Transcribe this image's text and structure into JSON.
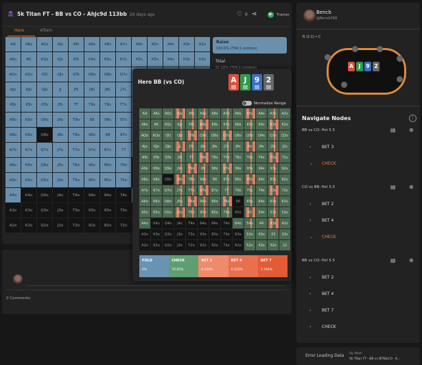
{
  "header": {
    "title": "5k Titan FT - BB vs CO - AhJc9d 113bb",
    "ago": "26 days ago",
    "like_count": "0",
    "trainer": "Trainer"
  },
  "tabs": {
    "hero": "Hero",
    "villain": "Villain"
  },
  "stats": {
    "raise_label": "Raise",
    "raise_value": "100.0% (704.1 combos)",
    "total_label": "Total",
    "total_value": "51.10% (704.1 combos)"
  },
  "overlay": {
    "title": "Hero BB (vs CO)",
    "normalize": "Normalize Range",
    "cards": [
      {
        "rank": "A",
        "color": "#d9503f"
      },
      {
        "rank": "J",
        "color": "#2e9a4c"
      },
      {
        "rank": "9",
        "color": "#3a6fc4"
      },
      {
        "rank": "2",
        "color": "#686868"
      }
    ]
  },
  "hands": [
    [
      "AA",
      "AKs",
      "AQs",
      "AJs",
      "ATs",
      "A9s",
      "A8s",
      "A7s",
      "A6s",
      "A5s",
      "A4s",
      "A3s",
      "A2s"
    ],
    [
      "AKo",
      "KK",
      "KQs",
      "KJs",
      "KTs",
      "K9s",
      "K8s",
      "K7s",
      "K6s",
      "K5s",
      "K4s",
      "K3s",
      "K2s"
    ],
    [
      "AQo",
      "KQo",
      "QQ",
      "QJs",
      "QTs",
      "Q9s",
      "Q8s",
      "Q7s",
      "Q6s",
      "Q5s",
      "Q4s",
      "Q3s",
      "Q2s"
    ],
    [
      "AJo",
      "KJo",
      "QJo",
      "JJ",
      "JTs",
      "J9s",
      "J8s",
      "J7s",
      "J6s",
      "J5s",
      "J4s",
      "J3s",
      "J2s"
    ],
    [
      "ATo",
      "KTo",
      "QTo",
      "JTo",
      "TT",
      "T9s",
      "T8s",
      "T7s",
      "T6s",
      "T5s",
      "T4s",
      "T3s",
      "T2s"
    ],
    [
      "A9o",
      "K9o",
      "Q9o",
      "J9o",
      "T9o",
      "99",
      "98s",
      "97s",
      "96s",
      "95s",
      "94s",
      "93s",
      "92s"
    ],
    [
      "A8o",
      "K8o",
      "Q8o",
      "J8o",
      "T8o",
      "98o",
      "88",
      "87s",
      "86s",
      "85s",
      "84s",
      "83s",
      "82s"
    ],
    [
      "A7o",
      "K7o",
      "Q7o",
      "J7o",
      "T7o",
      "97o",
      "87o",
      "77",
      "76s",
      "75s",
      "74s",
      "73s",
      "72s"
    ],
    [
      "A6o",
      "K6o",
      "Q6o",
      "J6o",
      "T6o",
      "96o",
      "86o",
      "76o",
      "66",
      "65s",
      "64s",
      "63s",
      "62s"
    ],
    [
      "A5o",
      "K5o",
      "Q5o",
      "J5o",
      "T5o",
      "95o",
      "85o",
      "75o",
      "65o",
      "55",
      "54s",
      "53s",
      "52s"
    ],
    [
      "A4o",
      "K4o",
      "Q4o",
      "J4o",
      "T4o",
      "94o",
      "84o",
      "74o",
      "64o",
      "54o",
      "44",
      "43s",
      "42s"
    ],
    [
      "A3o",
      "K3o",
      "Q3o",
      "J3o",
      "T3o",
      "93o",
      "83o",
      "73o",
      "63o",
      "53o",
      "43o",
      "33",
      "32s"
    ],
    [
      "A2o",
      "K2o",
      "Q2o",
      "J2o",
      "T2o",
      "92o",
      "82o",
      "72o",
      "62o",
      "52o",
      "42o",
      "32o",
      "22"
    ]
  ],
  "legend": [
    {
      "label": "FOLD",
      "value": "0%",
      "color": "#6a93b3"
    },
    {
      "label": "CHECK",
      "value": "76.65%",
      "color": "#5f9e73"
    },
    {
      "label": "BET 2",
      "value": "0.459%",
      "color": "#ef8a6c"
    },
    {
      "label": "BET 4",
      "value": "6.322%",
      "color": "#e8704f"
    },
    {
      "label": "BET 7",
      "value": "1.764%",
      "color": "#e35b36"
    }
  ],
  "comments": {
    "count": "0 Comments"
  },
  "user": {
    "name": "Bencb",
    "handle": "@Bencb789"
  },
  "table": {
    "stage": "R (2.1) • C",
    "board": [
      "A",
      "J",
      "9",
      "2"
    ]
  },
  "nav": {
    "title": "Navigate Nodes",
    "groups": [
      {
        "head": "BB vs CO: Pot 5.5",
        "items": [
          {
            "label": "BET 3",
            "active": false
          },
          {
            "label": "CHECK",
            "active": true
          }
        ]
      },
      {
        "head": "CO vs BB: Pot 5.5",
        "items": [
          {
            "label": "BET 2",
            "active": false
          },
          {
            "label": "BET 4",
            "active": false
          },
          {
            "label": "CHECK",
            "active": true
          }
        ]
      },
      {
        "head": "BB vs CO: Pot 5.5",
        "items": [
          {
            "label": "BET 2",
            "active": false
          },
          {
            "label": "BET 4",
            "active": false
          },
          {
            "label": "BET 7",
            "active": false
          },
          {
            "label": "CHECK",
            "active": false
          }
        ]
      }
    ]
  },
  "footer": {
    "error": "Error Loading Data",
    "up_next": "Up Next:",
    "next_title": "5k Titan FT - BB vs BTN&CO - K..."
  }
}
